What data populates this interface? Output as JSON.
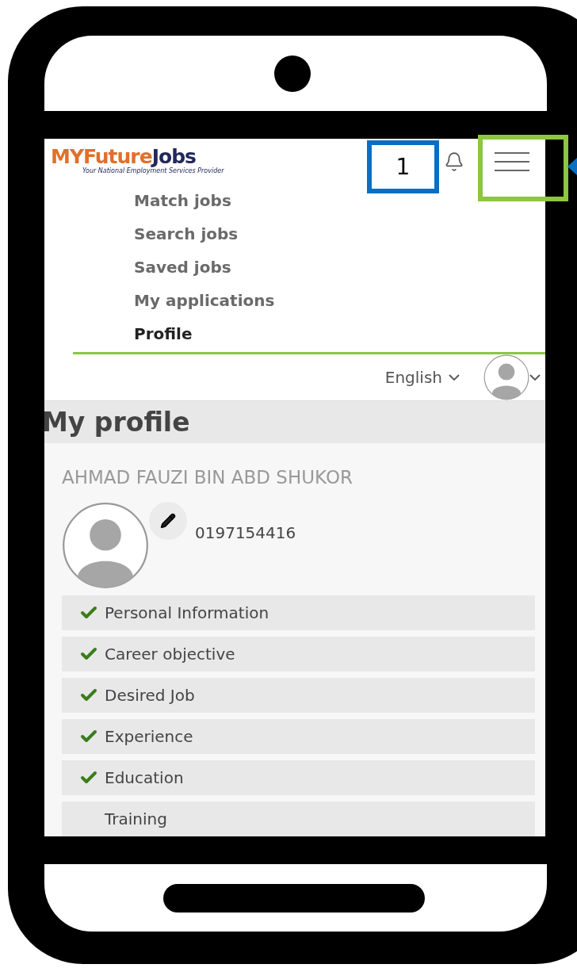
{
  "annotation": {
    "label": "1"
  },
  "header": {
    "logo": {
      "part_1": "MYFuture",
      "part_2": "Jobs",
      "tagline": "Your National Employment Services Provider"
    }
  },
  "nav": [
    {
      "label": "Match jobs",
      "selected": false
    },
    {
      "label": "Search jobs",
      "selected": false
    },
    {
      "label": "Saved jobs",
      "selected": false
    },
    {
      "label": "My applications",
      "selected": false
    },
    {
      "label": "Profile",
      "selected": true
    }
  ],
  "language": "English",
  "page_title": "My profile",
  "profile": {
    "name": "AHMAD FAUZI BIN ABD SHUKOR",
    "phone": "0197154416"
  },
  "sections": [
    {
      "label": "Personal Information",
      "completed": true
    },
    {
      "label": "Career objective",
      "completed": true
    },
    {
      "label": "Desired Job",
      "completed": true
    },
    {
      "label": "Experience",
      "completed": true
    },
    {
      "label": "Education",
      "completed": true
    },
    {
      "label": "Training",
      "completed": false
    }
  ]
}
